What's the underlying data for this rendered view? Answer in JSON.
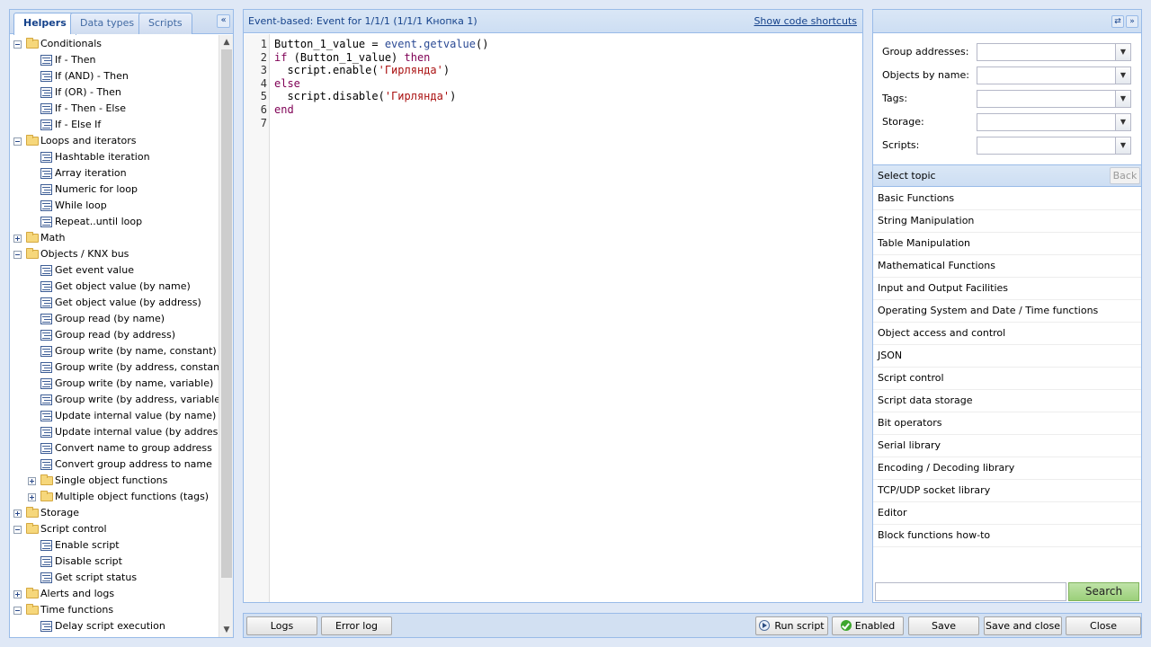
{
  "left_panel": {
    "tabs": [
      {
        "label": "Helpers",
        "active": true
      },
      {
        "label": "Data types",
        "active": false
      },
      {
        "label": "Scripts",
        "active": false
      }
    ],
    "collapse_icon": "double-chevron-left-icon",
    "tree": [
      {
        "label": "Conditionals",
        "type": "folder",
        "expanded": true,
        "level": 0
      },
      {
        "label": "If - Then",
        "type": "leaf",
        "level": 1
      },
      {
        "label": "If (AND) - Then",
        "type": "leaf",
        "level": 1
      },
      {
        "label": "If (OR) - Then",
        "type": "leaf",
        "level": 1
      },
      {
        "label": "If - Then - Else",
        "type": "leaf",
        "level": 1
      },
      {
        "label": "If - Else If",
        "type": "leaf",
        "level": 1
      },
      {
        "label": "Loops and iterators",
        "type": "folder",
        "expanded": true,
        "level": 0
      },
      {
        "label": "Hashtable iteration",
        "type": "leaf",
        "level": 1
      },
      {
        "label": "Array iteration",
        "type": "leaf",
        "level": 1
      },
      {
        "label": "Numeric for loop",
        "type": "leaf",
        "level": 1
      },
      {
        "label": "While loop",
        "type": "leaf",
        "level": 1
      },
      {
        "label": "Repeat..until loop",
        "type": "leaf",
        "level": 1
      },
      {
        "label": "Math",
        "type": "folder",
        "expanded": false,
        "level": 0
      },
      {
        "label": "Objects / KNX bus",
        "type": "folder",
        "expanded": true,
        "level": 0
      },
      {
        "label": "Get event value",
        "type": "leaf",
        "level": 1
      },
      {
        "label": "Get object value (by name)",
        "type": "leaf",
        "level": 1
      },
      {
        "label": "Get object value (by address)",
        "type": "leaf",
        "level": 1
      },
      {
        "label": "Group read (by name)",
        "type": "leaf",
        "level": 1
      },
      {
        "label": "Group read (by address)",
        "type": "leaf",
        "level": 1
      },
      {
        "label": "Group write (by name, constant)",
        "type": "leaf",
        "level": 1
      },
      {
        "label": "Group write (by address, constant)",
        "type": "leaf",
        "level": 1
      },
      {
        "label": "Group write (by name, variable)",
        "type": "leaf",
        "level": 1
      },
      {
        "label": "Group write (by address, variable)",
        "type": "leaf",
        "level": 1
      },
      {
        "label": "Update internal value (by name)",
        "type": "leaf",
        "level": 1
      },
      {
        "label": "Update internal value (by address)",
        "type": "leaf",
        "level": 1
      },
      {
        "label": "Convert name to group address",
        "type": "leaf",
        "level": 1
      },
      {
        "label": "Convert group address to name",
        "type": "leaf",
        "level": 1
      },
      {
        "label": "Single object functions",
        "type": "folder",
        "expanded": false,
        "level": 1
      },
      {
        "label": "Multiple object functions (tags)",
        "type": "folder",
        "expanded": false,
        "level": 1
      },
      {
        "label": "Storage",
        "type": "folder",
        "expanded": false,
        "level": 0
      },
      {
        "label": "Script control",
        "type": "folder",
        "expanded": true,
        "level": 0
      },
      {
        "label": "Enable script",
        "type": "leaf",
        "level": 1
      },
      {
        "label": "Disable script",
        "type": "leaf",
        "level": 1
      },
      {
        "label": "Get script status",
        "type": "leaf",
        "level": 1
      },
      {
        "label": "Alerts and logs",
        "type": "folder",
        "expanded": false,
        "level": 0
      },
      {
        "label": "Time functions",
        "type": "folder",
        "expanded": true,
        "level": 0
      },
      {
        "label": "Delay script execution",
        "type": "leaf",
        "level": 1
      }
    ]
  },
  "editor": {
    "title": "Event-based: Event for 1/1/1 (1/1/1 Кнопка 1)",
    "shortcuts_link": "Show code shortcuts",
    "lines": [
      [
        {
          "t": "Button_1_value = "
        },
        {
          "t": "event.getvalue",
          "c": "fn"
        },
        {
          "t": "()"
        }
      ],
      [
        {
          "t": "if",
          "c": "kw"
        },
        {
          "t": " (Button_1_value) "
        },
        {
          "t": "then",
          "c": "kw"
        }
      ],
      [
        {
          "t": "  script.enable("
        },
        {
          "t": "'Гирлянда'",
          "c": "str"
        },
        {
          "t": ")"
        }
      ],
      [
        {
          "t": "else",
          "c": "kw"
        }
      ],
      [
        {
          "t": "  script.disable("
        },
        {
          "t": "'Гирлянда'",
          "c": "str"
        },
        {
          "t": ")"
        }
      ],
      [
        {
          "t": "end",
          "c": "kw"
        }
      ],
      []
    ]
  },
  "right_panel": {
    "header_icons": [
      "refresh-icon",
      "double-chevron-right-icon"
    ],
    "filters": [
      {
        "label": "Group addresses:",
        "value": ""
      },
      {
        "label": "Objects by name:",
        "value": ""
      },
      {
        "label": "Tags:",
        "value": ""
      },
      {
        "label": "Storage:",
        "value": ""
      },
      {
        "label": "Scripts:",
        "value": ""
      }
    ],
    "topic_header": "Select topic",
    "back_label": "Back",
    "topics": [
      "Basic Functions",
      "String Manipulation",
      "Table Manipulation",
      "Mathematical Functions",
      "Input and Output Facilities",
      "Operating System and Date / Time functions",
      "Object access and control",
      "JSON",
      "Script control",
      "Script data storage",
      "Bit operators",
      "Serial library",
      "Encoding / Decoding library",
      "TCP/UDP socket library",
      "Editor",
      "Block functions how-to"
    ],
    "search_value": "",
    "search_label": "Search"
  },
  "bottom_bar": {
    "logs": "Logs",
    "error_log": "Error log",
    "run_script": "Run script",
    "enabled": "Enabled",
    "save": "Save",
    "save_and_close": "Save and close",
    "close": "Close"
  }
}
